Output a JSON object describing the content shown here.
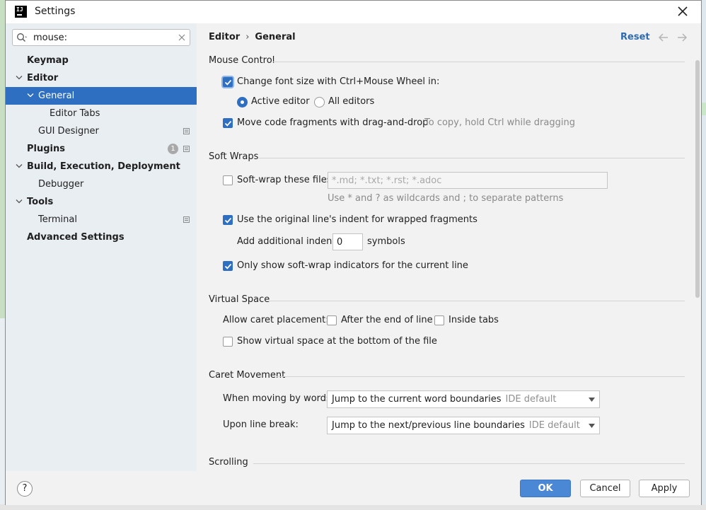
{
  "window": {
    "title": "Settings"
  },
  "search": {
    "value": "mouse:"
  },
  "sidebar": {
    "items": [
      {
        "label": "Keymap"
      },
      {
        "label": "Editor"
      },
      {
        "label": "General"
      },
      {
        "label": "Editor Tabs"
      },
      {
        "label": "GUI Designer"
      },
      {
        "label": "Plugins",
        "badge": "1"
      },
      {
        "label": "Build, Execution, Deployment"
      },
      {
        "label": "Debugger"
      },
      {
        "label": "Tools"
      },
      {
        "label": "Terminal"
      },
      {
        "label": "Advanced Settings"
      }
    ]
  },
  "header": {
    "breadcrumb_parent": "Editor",
    "breadcrumb_sep": "›",
    "breadcrumb_current": "General",
    "reset_label": "Reset"
  },
  "mouse_control": {
    "title": "Mouse Control",
    "font_size_label": "Change font size with Ctrl+Mouse Wheel in:",
    "font_size_checked": true,
    "radio_active": "Active editor",
    "radio_all": "All editors",
    "selected_radio": "Active editor",
    "drag_drop_label": "Move code fragments with drag-and-drop",
    "drag_drop_checked": true,
    "drag_drop_hint": "To copy, hold Ctrl while dragging"
  },
  "soft_wraps": {
    "title": "Soft Wraps",
    "soft_wrap_label": "Soft-wrap these files:",
    "soft_wrap_checked": false,
    "soft_wrap_patterns": "*.md; *.txt; *.rst; *.adoc",
    "soft_wrap_hint": "Use * and ? as wildcards and ; to separate patterns",
    "original_indent_label": "Use the original line's indent for wrapped fragments",
    "original_indent_checked": true,
    "additional_indent_label": "Add additional indent:",
    "additional_indent_value": "0",
    "symbols_label": "symbols",
    "indicators_label": "Only show soft-wrap indicators for the current line",
    "indicators_checked": true
  },
  "virtual_space": {
    "title": "Virtual Space",
    "caret_placement_label": "Allow caret placement:",
    "after_end_label": "After the end of line",
    "after_end_checked": false,
    "inside_tabs_label": "Inside tabs",
    "inside_tabs_checked": false,
    "show_virtual_label": "Show virtual space at the bottom of the file",
    "show_virtual_checked": false
  },
  "caret_movement": {
    "title": "Caret Movement",
    "by_words_label": "When moving by words:",
    "by_words_value": "Jump to the current word boundaries",
    "by_words_default": "IDE default",
    "line_break_label": "Upon line break:",
    "line_break_value": "Jump to the next/previous line boundaries",
    "line_break_default": "IDE default"
  },
  "scrolling": {
    "title": "Scrolling"
  },
  "footer": {
    "help_label": "?",
    "ok_label": "OK",
    "cancel_label": "Cancel",
    "apply_label": "Apply"
  },
  "colors": {
    "accent": "#2f6fc1",
    "link": "#2e6bb0",
    "primary_button": "#4a87d4",
    "sidebar_bg": "#e9eef3",
    "content_bg": "#f2f2f2"
  },
  "icons": {
    "app": "intellij-logo-icon",
    "close": "close-icon",
    "search": "search-icon",
    "clear": "clear-icon",
    "back": "arrow-left-icon",
    "forward": "arrow-right-icon"
  }
}
